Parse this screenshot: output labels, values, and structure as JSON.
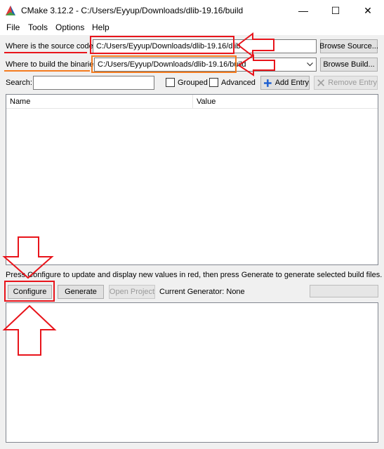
{
  "window": {
    "title": "CMake 3.12.2 - C:/Users/Eyyup/Downloads/dlib-19.16/build",
    "minimize_glyph": "—",
    "maximize_glyph": "☐",
    "close_glyph": "✕"
  },
  "menu": [
    "File",
    "Tools",
    "Options",
    "Help"
  ],
  "source": {
    "label": "Where is the source code:",
    "value": "C:/Users/Eyyup/Downloads/dlib-19.16/dlib",
    "browse_label": "Browse Source..."
  },
  "build": {
    "label": "Where to build the binaries:",
    "value": "C:/Users/Eyyup/Downloads/dlib-19.16/build",
    "browse_label": "Browse Build..."
  },
  "search": {
    "label": "Search:",
    "value": "",
    "grouped_label": "Grouped",
    "grouped_checked": false,
    "advanced_label": "Advanced",
    "advanced_checked": false,
    "add_entry_label": "Add Entry",
    "remove_entry_label": "Remove Entry"
  },
  "table": {
    "columns": [
      "Name",
      "Value"
    ]
  },
  "info_text": "Press Configure to update and display new values in red, then press Generate to generate selected build files.",
  "actions": {
    "configure_label": "Configure",
    "generate_label": "Generate",
    "open_project_label": "Open Project",
    "generator_text": "Current Generator: None"
  },
  "annotation_colors": {
    "red": "#e8141b",
    "orange": "#f57c1f"
  },
  "icons": {
    "app": "cmake-triangle-icon",
    "add": "plus-icon",
    "remove": "remove-x-icon",
    "dropdown": "chevron-down-icon"
  }
}
